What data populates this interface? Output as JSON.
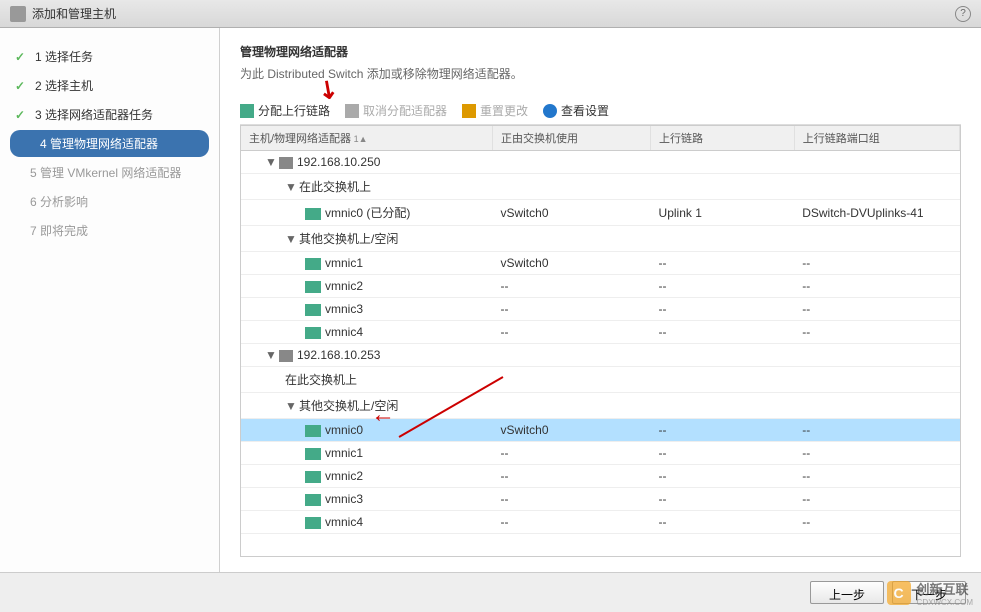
{
  "titlebar": {
    "title": "添加和管理主机"
  },
  "sidebar": {
    "steps": [
      {
        "num": "1",
        "label": "选择任务",
        "state": "done"
      },
      {
        "num": "2",
        "label": "选择主机",
        "state": "done"
      },
      {
        "num": "3",
        "label": "选择网络适配器任务",
        "state": "done"
      },
      {
        "num": "4",
        "label": "管理物理网络适配器",
        "state": "active"
      },
      {
        "num": "5",
        "label": "管理 VMkernel 网络适配器",
        "state": "pending"
      },
      {
        "num": "6",
        "label": "分析影响",
        "state": "pending"
      },
      {
        "num": "7",
        "label": "即将完成",
        "state": "pending"
      }
    ]
  },
  "content": {
    "title": "管理物理网络适配器",
    "desc": "为此 Distributed Switch 添加或移除物理网络适配器。"
  },
  "toolbar": {
    "assign": "分配上行链路",
    "unassign": "取消分配适配器",
    "reset": "重置更改",
    "view": "查看设置"
  },
  "table": {
    "headers": {
      "adapter": "主机/物理网络适配器",
      "inuse": "正由交换机使用",
      "uplink": "上行链路",
      "portgroup": "上行链路端口组"
    },
    "rows": [
      {
        "type": "host",
        "indent": 0,
        "exp": "▼",
        "label": "192.168.10.250",
        "inuse": "",
        "uplink": "",
        "pg": ""
      },
      {
        "type": "group",
        "indent": 1,
        "exp": "▼",
        "label": "在此交换机上",
        "inuse": "",
        "uplink": "",
        "pg": ""
      },
      {
        "type": "nic",
        "indent": 2,
        "exp": "",
        "label": "vmnic0 (已分配)",
        "inuse": "vSwitch0",
        "uplink": "Uplink 1",
        "pg": "DSwitch-DVUplinks-41"
      },
      {
        "type": "group",
        "indent": 1,
        "exp": "▼",
        "label": "其他交换机上/空闲",
        "inuse": "",
        "uplink": "",
        "pg": ""
      },
      {
        "type": "nic",
        "indent": 2,
        "exp": "",
        "label": "vmnic1",
        "inuse": "vSwitch0",
        "uplink": "--",
        "pg": "--"
      },
      {
        "type": "nic",
        "indent": 2,
        "exp": "",
        "label": "vmnic2",
        "inuse": "--",
        "uplink": "--",
        "pg": "--"
      },
      {
        "type": "nic",
        "indent": 2,
        "exp": "",
        "label": "vmnic3",
        "inuse": "--",
        "uplink": "--",
        "pg": "--"
      },
      {
        "type": "nic",
        "indent": 2,
        "exp": "",
        "label": "vmnic4",
        "inuse": "--",
        "uplink": "--",
        "pg": "--"
      },
      {
        "type": "host",
        "indent": 0,
        "exp": "▼",
        "label": "192.168.10.253",
        "inuse": "",
        "uplink": "",
        "pg": ""
      },
      {
        "type": "group",
        "indent": 1,
        "exp": "",
        "label": "在此交换机上",
        "inuse": "",
        "uplink": "",
        "pg": ""
      },
      {
        "type": "group",
        "indent": 1,
        "exp": "▼",
        "label": "其他交换机上/空闲",
        "inuse": "",
        "uplink": "",
        "pg": ""
      },
      {
        "type": "nic",
        "indent": 2,
        "exp": "",
        "label": "vmnic0",
        "inuse": "vSwitch0",
        "uplink": "--",
        "pg": "--",
        "selected": true
      },
      {
        "type": "nic",
        "indent": 2,
        "exp": "",
        "label": "vmnic1",
        "inuse": "--",
        "uplink": "--",
        "pg": "--"
      },
      {
        "type": "nic",
        "indent": 2,
        "exp": "",
        "label": "vmnic2",
        "inuse": "--",
        "uplink": "--",
        "pg": "--"
      },
      {
        "type": "nic",
        "indent": 2,
        "exp": "",
        "label": "vmnic3",
        "inuse": "--",
        "uplink": "--",
        "pg": "--"
      },
      {
        "type": "nic",
        "indent": 2,
        "exp": "",
        "label": "vmnic4",
        "inuse": "--",
        "uplink": "--",
        "pg": "--"
      }
    ]
  },
  "footer": {
    "prev": "上一步",
    "next": "下一步"
  },
  "watermark": {
    "brand": "创新互联",
    "sub": "CDXWCX.COM"
  }
}
